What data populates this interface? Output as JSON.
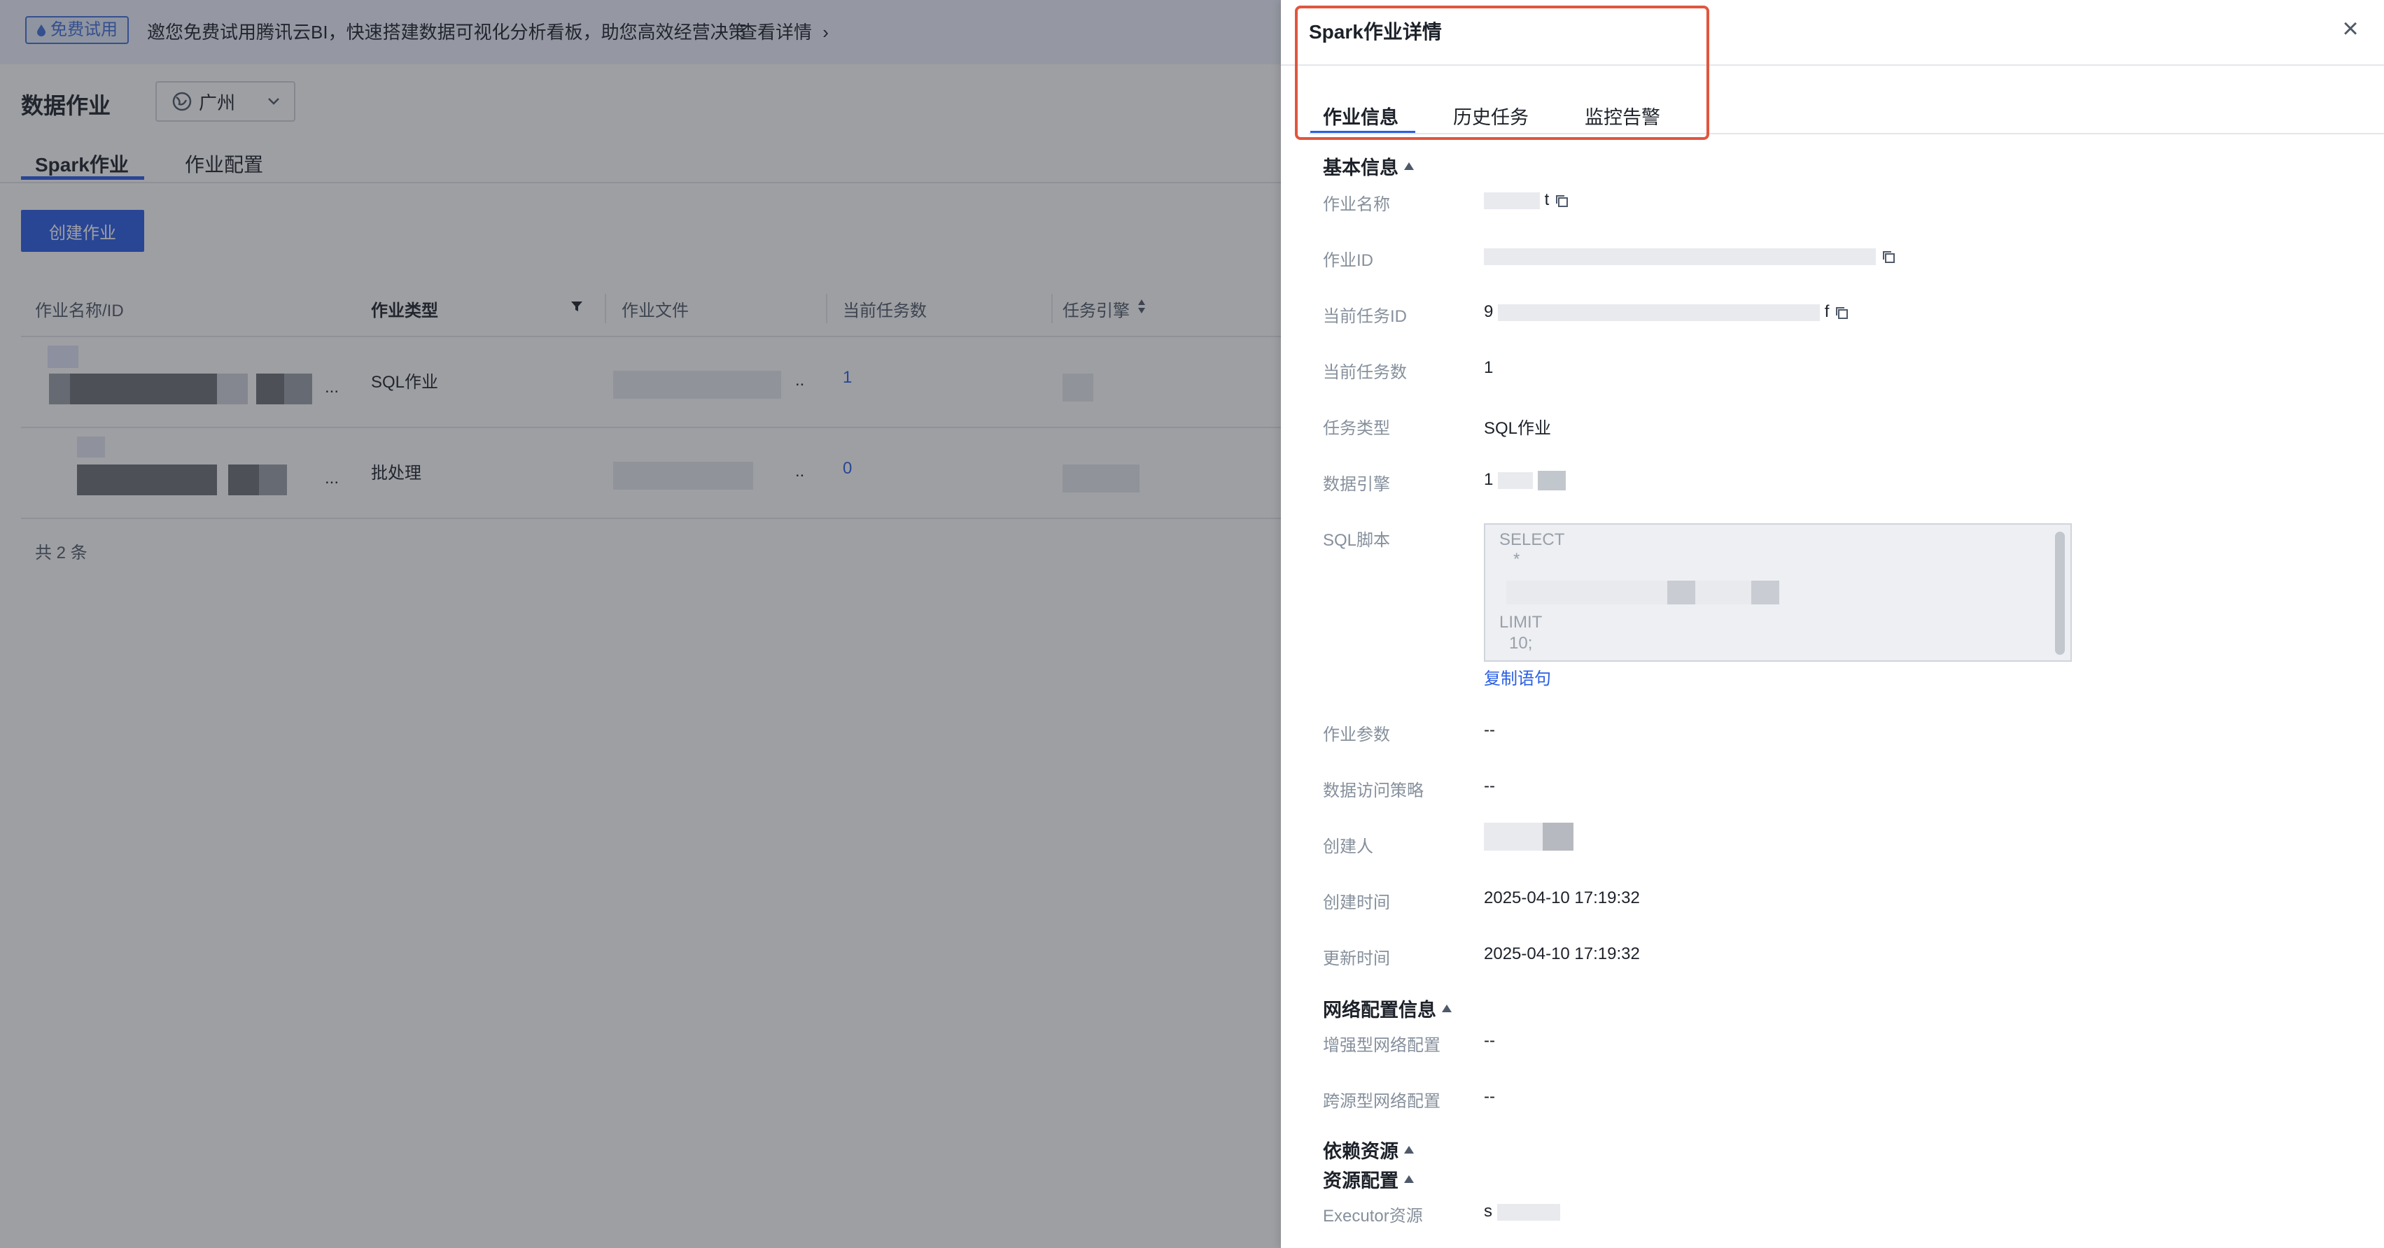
{
  "banner": {
    "badge": "免费试用",
    "text": "邀您免费试用腾讯云BI，快速搭建数据可视化分析看板，助您高效经营决策",
    "link": "查看详情"
  },
  "page": {
    "title": "数据作业",
    "region": "广州",
    "tabs": [
      "Spark作业",
      "作业配置"
    ],
    "create_button": "创建作业"
  },
  "table": {
    "columns": [
      "作业名称/ID",
      "作业类型",
      "作业文件",
      "当前任务数",
      "任务引擎"
    ],
    "rows": [
      {
        "type": "SQL作业",
        "count": "1",
        "ellipsis": "...",
        "file_ellipsis": ".."
      },
      {
        "type": "批处理",
        "count": "0",
        "ellipsis": "...",
        "file_ellipsis": ".."
      }
    ],
    "footer": "共 2 条"
  },
  "drawer": {
    "title": "Spark作业详情",
    "tabs": [
      "作业信息",
      "历史任务",
      "监控告警"
    ],
    "sections": {
      "basic": "基本信息",
      "network": "网络配置信息",
      "dependency": "依赖资源",
      "resource": "资源配置"
    },
    "labels": {
      "job_name": "作业名称",
      "job_id": "作业ID",
      "current_task_id": "当前任务ID",
      "current_task_count": "当前任务数",
      "task_type": "任务类型",
      "data_engine": "数据引擎",
      "sql_script": "SQL脚本",
      "job_params": "作业参数",
      "access_policy": "数据访问策略",
      "creator": "创建人",
      "create_time": "创建时间",
      "update_time": "更新时间",
      "enhanced_network": "增强型网络配置",
      "cross_source_network": "跨源型网络配置",
      "executor": "Executor资源"
    },
    "values": {
      "job_name_suffix": "t",
      "current_task_id_prefix": "9",
      "current_task_id_suffix": "f",
      "current_task_count": "1",
      "task_type": "SQL作业",
      "data_engine_prefix": "1",
      "job_params": "--",
      "access_policy": "--",
      "create_time": "2025-04-10 17:19:32",
      "update_time": "2025-04-10 17:19:32",
      "enhanced_network": "--",
      "cross_source_network": "--",
      "executor_prefix": "s"
    },
    "sql_lines": [
      "SELECT",
      "*",
      "LIMIT",
      "10;"
    ],
    "copy_statement": "复制语句"
  }
}
